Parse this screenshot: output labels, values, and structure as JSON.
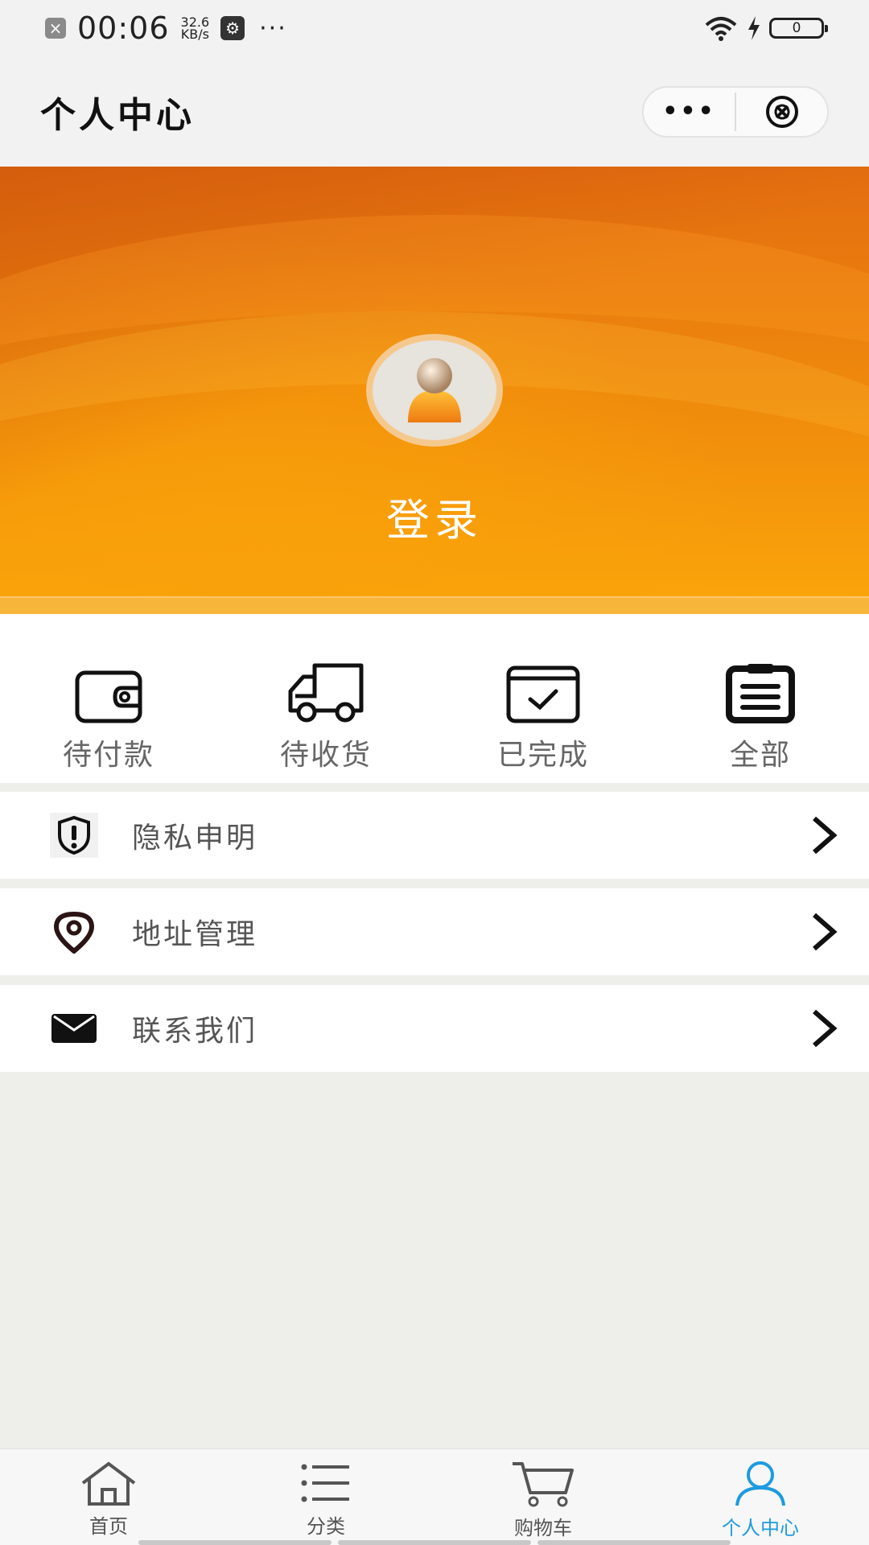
{
  "status_bar": {
    "time": "00:06",
    "speed_value": "32.6",
    "speed_unit": "KB/s",
    "battery": "0"
  },
  "header": {
    "title": "个人中心",
    "more_icon": "more-dots-icon",
    "close_icon": "close-circle-icon"
  },
  "banner": {
    "login_label": "登录",
    "colors": {
      "start": "#e36d10",
      "end": "#fba60a"
    }
  },
  "orders": [
    {
      "label": "待付款",
      "icon": "wallet-icon"
    },
    {
      "label": "待收货",
      "icon": "truck-icon"
    },
    {
      "label": "已完成",
      "icon": "completed-check-icon"
    },
    {
      "label": "全部",
      "icon": "clipboard-list-icon"
    }
  ],
  "menu": [
    {
      "label": "隐私申明",
      "icon": "shield-alert-icon"
    },
    {
      "label": "地址管理",
      "icon": "location-pin-icon"
    },
    {
      "label": "联系我们",
      "icon": "mail-icon"
    }
  ],
  "tab_bar": {
    "items": [
      {
        "label": "首页",
        "icon": "home-icon"
      },
      {
        "label": "分类",
        "icon": "category-list-icon"
      },
      {
        "label": "购物车",
        "icon": "cart-icon"
      },
      {
        "label": "个人中心",
        "icon": "user-icon",
        "active": true
      }
    ],
    "active_color": "#1e9be0"
  }
}
